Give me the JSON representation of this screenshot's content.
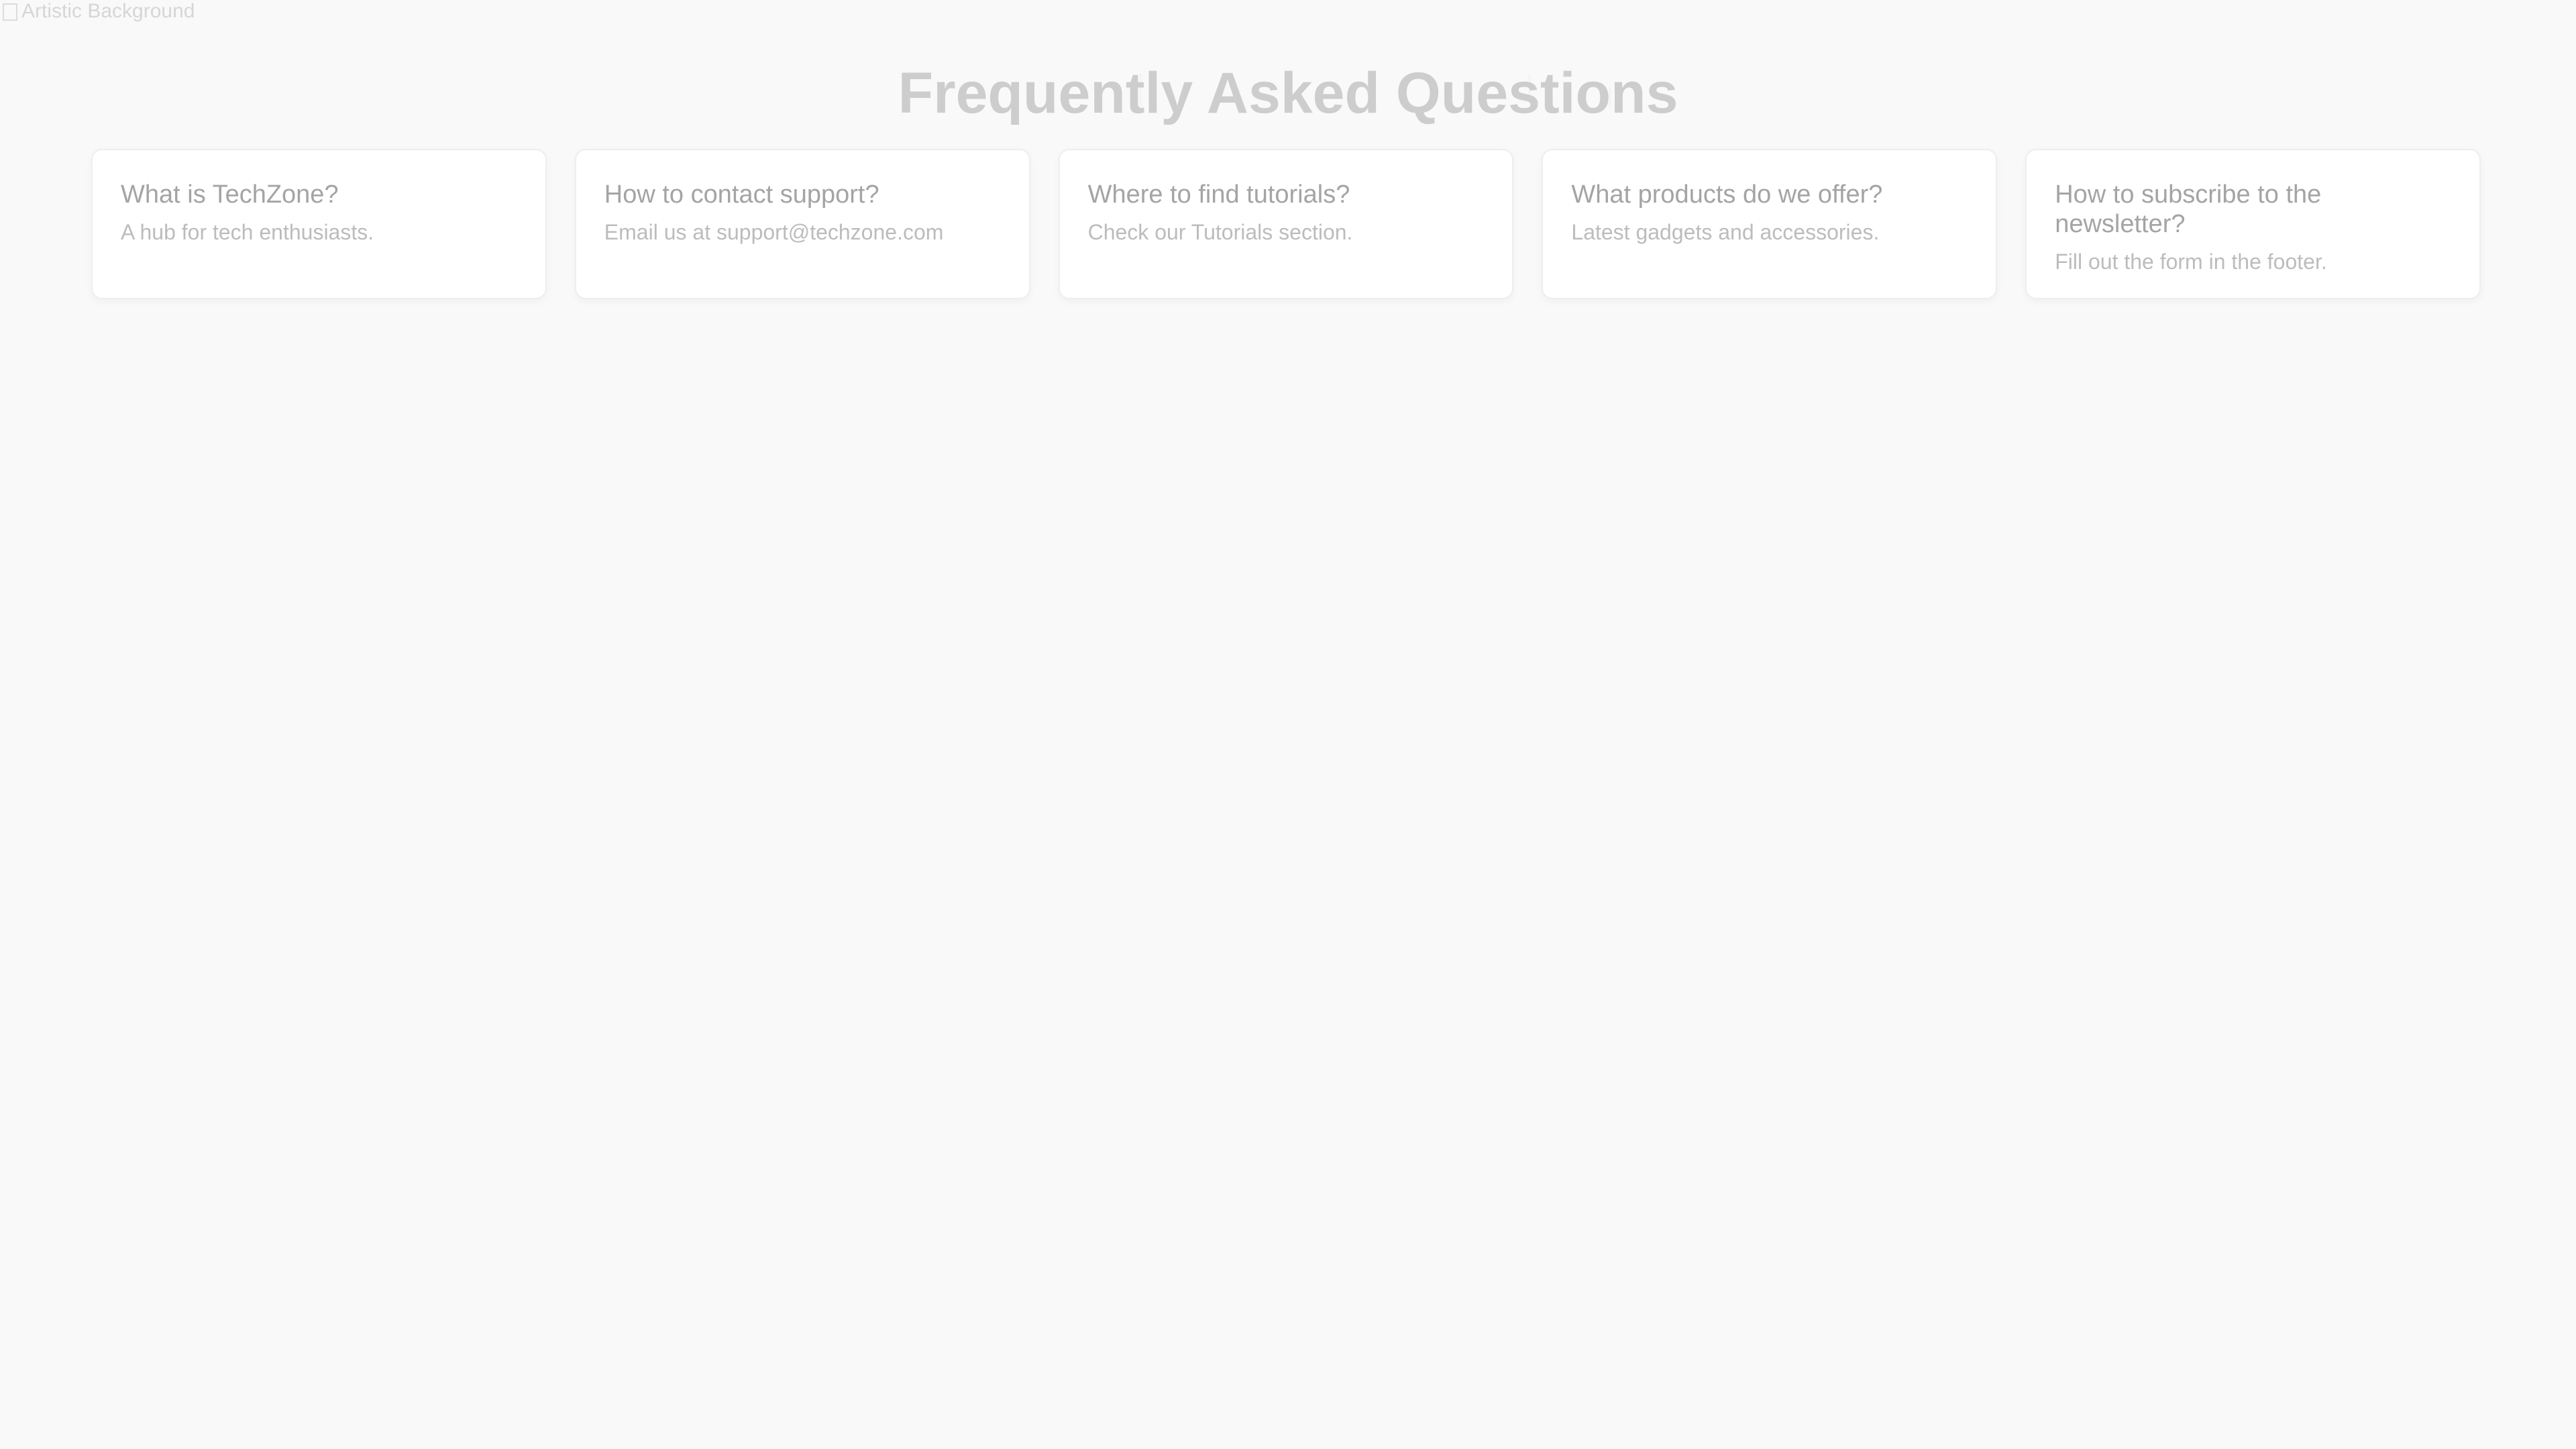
{
  "background": {
    "alt_text": "Artistic Background"
  },
  "page": {
    "title": "Frequently Asked Questions"
  },
  "faq": [
    {
      "question": "What is TechZone?",
      "answer": "A hub for tech enthusiasts."
    },
    {
      "question": "How to contact support?",
      "answer": "Email us at support@techzone.com"
    },
    {
      "question": "Where to find tutorials?",
      "answer": "Check our Tutorials section."
    },
    {
      "question": "What products do we offer?",
      "answer": "Latest gadgets and accessories."
    },
    {
      "question": "How to subscribe to the newsletter?",
      "answer": "Fill out the form in the footer."
    }
  ],
  "colors": {
    "page_background": "#f9f9f9",
    "card_background": "#ffffff",
    "title": "#cdcdcd",
    "question": "#a4a4a4",
    "answer": "#bcbcbc"
  }
}
